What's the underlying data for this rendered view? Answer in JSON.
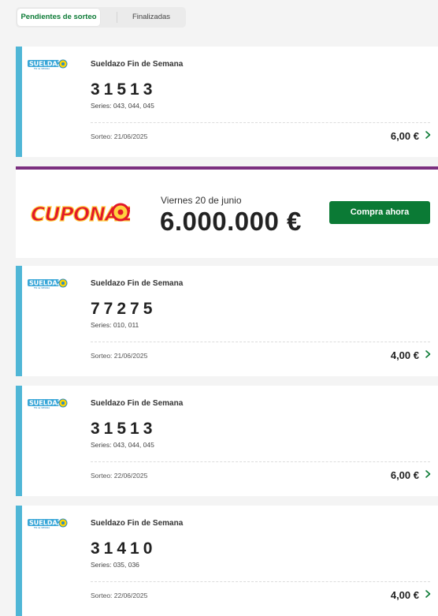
{
  "tabs": {
    "pending_label": "Pendientes de sorteo",
    "finished_label": "Finalizadas"
  },
  "accent_colors": {
    "green": "#0b7a35",
    "ticket_bar": "#4fb6d6",
    "promo_bar": "#7b2f7f"
  },
  "tickets": [
    {
      "logo_icon": "sueldazo-logo",
      "game": "Sueldazo Fin de Semana",
      "number": "31513",
      "series": "Series: 043, 044, 045",
      "draw": "Sorteo: 21/06/2025",
      "price": "6,00 €"
    },
    {
      "logo_icon": "sueldazo-logo",
      "game": "Sueldazo Fin de Semana",
      "number": "77275",
      "series": "Series: 010, 011",
      "draw": "Sorteo: 21/06/2025",
      "price": "4,00 €"
    },
    {
      "logo_icon": "sueldazo-logo",
      "game": "Sueldazo Fin de Semana",
      "number": "31513",
      "series": "Series: 043, 044, 045",
      "draw": "Sorteo: 22/06/2025",
      "price": "6,00 €"
    },
    {
      "logo_icon": "sueldazo-logo",
      "game": "Sueldazo Fin de Semana",
      "number": "31410",
      "series": "Series: 035, 036",
      "draw": "Sorteo: 22/06/2025",
      "price": "4,00 €"
    }
  ],
  "promo": {
    "logo_icon": "cuponazo-logo",
    "logo_text": "CUPONAZO",
    "date": "Viernes 20 de junio",
    "amount": "6.000.000 €",
    "button": "Compra ahora"
  }
}
